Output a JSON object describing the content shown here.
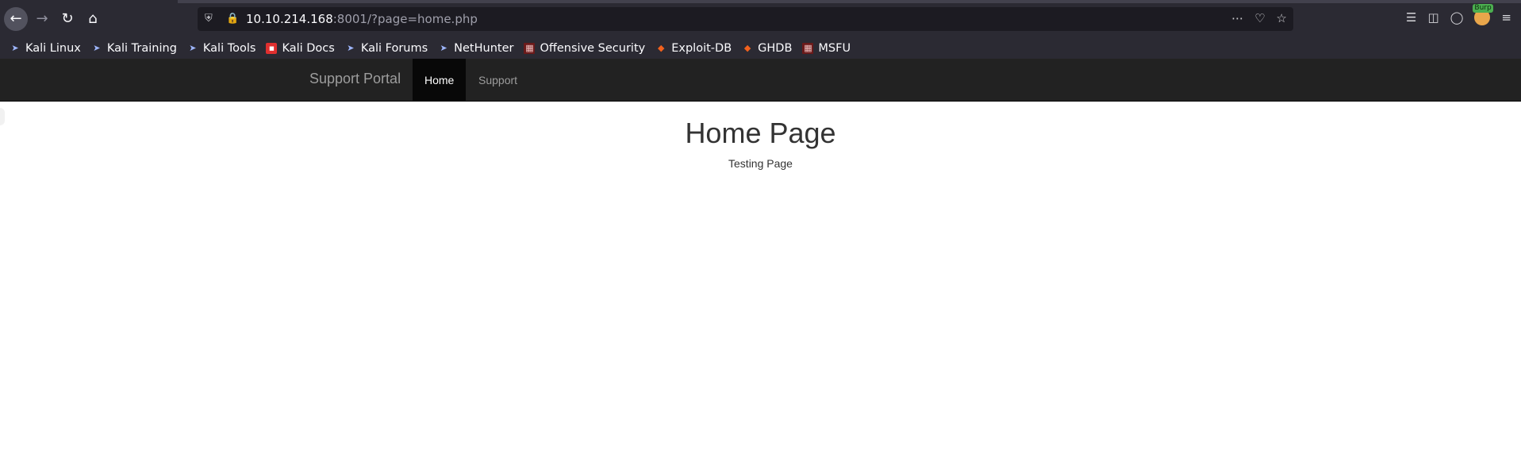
{
  "browser": {
    "url_host": "10.10.214.168",
    "url_rest": ":8001/?page=home.php",
    "icons": [
      "back-icon",
      "forward-icon",
      "reload-icon",
      "home-icon",
      "shield-icon",
      "insecure-lock-icon",
      "page-actions-icon",
      "pocket-icon",
      "star-icon",
      "library-icon",
      "sidebar-icon",
      "account-icon",
      "burp-extension-icon",
      "menu-icon"
    ],
    "burp_badge": "Burp"
  },
  "bookmarks": [
    {
      "label": "Kali Linux",
      "icon": "kali-dragon-icon"
    },
    {
      "label": "Kali Training",
      "icon": "kali-dragon-icon"
    },
    {
      "label": "Kali Tools",
      "icon": "kali-dragon-icon"
    },
    {
      "label": "Kali Docs",
      "icon": "kali-docs-icon"
    },
    {
      "label": "Kali Forums",
      "icon": "kali-dragon-icon"
    },
    {
      "label": "NetHunter",
      "icon": "kali-dragon-icon"
    },
    {
      "label": "Offensive Security",
      "icon": "offsec-icon"
    },
    {
      "label": "Exploit-DB",
      "icon": "exploit-db-icon"
    },
    {
      "label": "GHDB",
      "icon": "exploit-db-icon"
    },
    {
      "label": "MSFU",
      "icon": "offsec-icon"
    }
  ],
  "site": {
    "brand": "Support Portal",
    "nav": [
      {
        "label": "Home",
        "active": true
      },
      {
        "label": "Support",
        "active": false
      }
    ],
    "heading": "Home Page",
    "text": "Testing Page"
  },
  "colors": {
    "chrome_bg": "#2b2a33",
    "navbar_bg": "#222222",
    "active_tab_bg": "#080808"
  }
}
